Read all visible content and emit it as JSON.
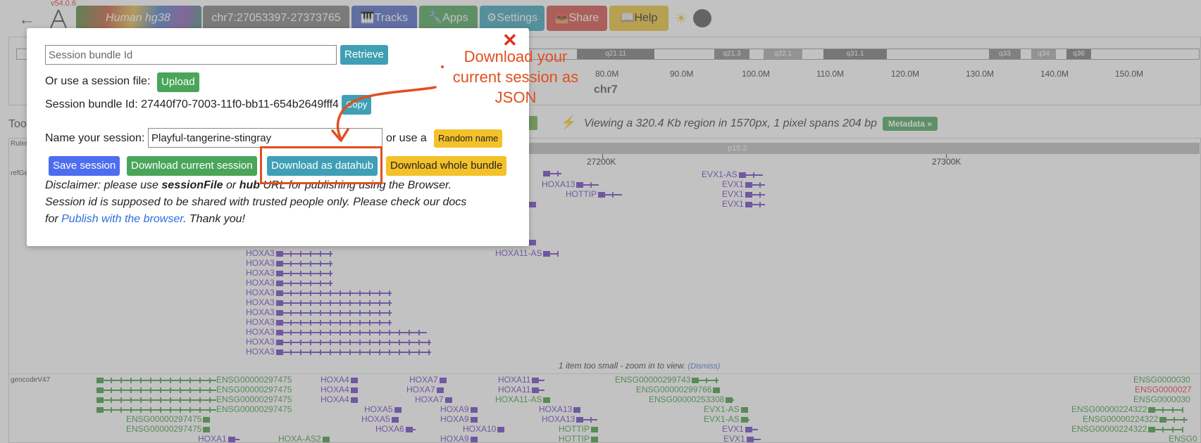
{
  "nav": {
    "version": "v54.0.6",
    "genome": "Human hg38",
    "location": "chr7:27053397-27373765",
    "tracks": "🎹Tracks",
    "apps": "🔧Apps",
    "settings": "⚙Settings",
    "share": "📤Share",
    "help": "📖Help"
  },
  "ideogram": {
    "bands": [
      "q21.11",
      "q21.3",
      "q22.1",
      "q31.1",
      "q33",
      "q34",
      "q36"
    ],
    "ticks": [
      "80.0M",
      "90.0M",
      "100.0M",
      "110.0M",
      "120.0M",
      "130.0M",
      "140.0M",
      "150.0M"
    ],
    "chrom": "chr7"
  },
  "toolbar": {
    "tools_label": "Too",
    "view_info": "Viewing a 320.4 Kb region in 1570px, 1 pixel spans 204 bp",
    "metadata": "Metadata »"
  },
  "tracks": {
    "ruler_label": "Ruler",
    "refgene_label": "refGe",
    "gencode_label": "gencodeV47",
    "ruler_band": "p15.2",
    "ruler_ticks": [
      "27200K",
      "27300K"
    ],
    "too_small": "1 item too small - zoom in to view.",
    "dismiss": "(Dismiss)"
  },
  "refgene": {
    "hoxa3": [
      "HOXA3",
      "HOXA3",
      "HOXA3",
      "HOXA3",
      "HOXA3",
      "HOXA3",
      "HOXA3",
      "HOXA3",
      "HOXA3",
      "HOXA3",
      "HOXA3"
    ],
    "hoxa13": "HOXA13",
    "hottip": "HOTTIP",
    "hoxa11as": "HOXA11-AS",
    "evx1as": "EVX1-AS",
    "evx1": [
      "EVX1",
      "EVX1",
      "EVX1"
    ]
  },
  "gencode": {
    "ensg_a": [
      "ENSG00000297475",
      "ENSG00000297475",
      "ENSG00000297475",
      "ENSG00000297475"
    ],
    "ensg_b": [
      "ENSG00000297475",
      "ENSG00000297475"
    ],
    "hoxa1": "HOXA1",
    "hoxa_as2": "HOXA-AS2",
    "hoxa4": [
      "HOXA4",
      "HOXA4",
      "HOXA4"
    ],
    "hoxa5": "HOXA5",
    "hoxa5b": "HOXA5",
    "hoxa6": "HOXA6",
    "hoxa7": [
      "HOXA7",
      "HOXA7",
      "HOXA7"
    ],
    "hoxa9": [
      "HOXA9",
      "HOXA9",
      "HOXA9"
    ],
    "hoxa10": "HOXA10",
    "hoxa11": [
      "HOXA11",
      "HOXA11"
    ],
    "hoxa11as": "HOXA11-AS",
    "hoxa13": [
      "HOXA13",
      "HOXA13"
    ],
    "hottip": [
      "HOTTIP",
      "HOTTIP"
    ],
    "ensg_c": [
      "ENSG00000299743",
      "ENSG00000299766",
      "ENSG00000253308"
    ],
    "evx1as": [
      "EVX1-AS",
      "EVX1-AS"
    ],
    "evx1": [
      "EVX1",
      "EVX1"
    ],
    "ensg_right": [
      "ENSG0000030",
      "ENSG0000027",
      "ENSG0000030"
    ],
    "ensg_224322": [
      "ENSG00000224322",
      "ENSG00000224322",
      "ENSG00000224322"
    ],
    "ensg_cut": "ENSG0"
  },
  "modal": {
    "bundle_placeholder": "Session bundle Id",
    "retrieve": "Retrieve",
    "or_use_file": "Or use a session file:",
    "upload": "Upload",
    "bundle_id_label": "Session bundle Id: 27440f70-7003-11f0-bb11-654b2649fff4",
    "copy": "Copy",
    "name_label": "Name your session:",
    "name_value": "Playful-tangerine-stingray",
    "or_use_a": "or use a",
    "random_name": "Random name",
    "save_session": "Save session",
    "download_current": "Download current session",
    "download_datahub": "Download as datahub",
    "download_bundle": "Download whole bundle",
    "disc_1a": "Disclaimer: please use ",
    "disc_1b": "sessionFile",
    "disc_1c": " or ",
    "disc_1d": "hub",
    "disc_1e": " URL for publishing using the Browser.",
    "disc_2": "Session id is supposed to be shared with trusted people only. Please check our docs",
    "disc_3a": "for ",
    "disc_3b": "Publish with the browser",
    "disc_3c": ". Thank you!",
    "close": "✕"
  },
  "annotation": {
    "callout": "Download your current session as JSON",
    "color": "#e0501e"
  },
  "icons": [
    "back-arrow-icon",
    "logo-icon",
    "sun-icon",
    "book-icon",
    "bolt-icon",
    "close-icon"
  ]
}
